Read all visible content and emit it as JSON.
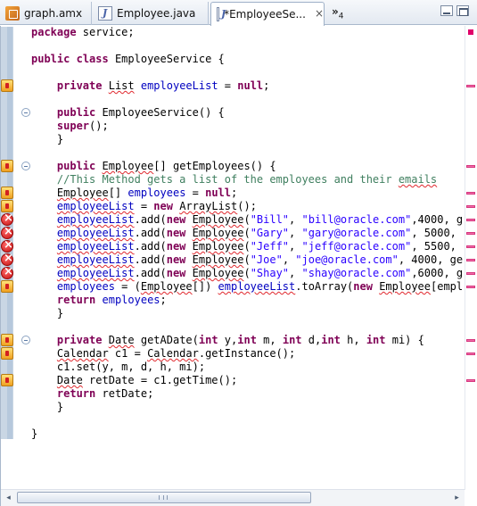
{
  "tabs": [
    {
      "label": "graph.amx",
      "icon": "amx-diagram-icon"
    },
    {
      "label": "Employee.java",
      "icon": "java-file-icon"
    },
    {
      "label": "*EmployeeSe...",
      "icon": "java-file-icon",
      "active": true,
      "close": "×"
    }
  ],
  "overflow": {
    "label": "»",
    "count": "4"
  },
  "code": {
    "l1": {
      "kw": "package",
      "rest": " service;"
    },
    "l3": {
      "kw1": "public",
      "kw2": "class",
      "rest": " EmployeeService {"
    },
    "l5": {
      "kw": "private",
      "type": "List",
      "field": "employeeList",
      "eq": " = ",
      "val": "null",
      "end": ";"
    },
    "l7": {
      "kw": "public",
      "rest": " EmployeeService() {"
    },
    "l8": {
      "kw": "super",
      "rest": "();"
    },
    "l9": {
      "text": "}"
    },
    "l11": {
      "kw": "public",
      "type": "Employee",
      "rest": "[] getEmployees() {"
    },
    "l12": {
      "comment": "//This Method gets a list of the employees and their ",
      "comment_err": "emails"
    },
    "l13": {
      "type": "Employee",
      "rest": "[] ",
      "field": "employees",
      "eq": " = ",
      "val": "null",
      "end": ";"
    },
    "l14": {
      "field": "employeeList",
      "eq": " = ",
      "kw": "new",
      "type": "ArrayList",
      "end": "();"
    },
    "rows": [
      {
        "field": "employeeList",
        "mid": ".add(",
        "kw": "new",
        "type": "Employee",
        "s1": "\"Bill\"",
        "c1": ", ",
        "s2": "\"bill@oracle.com\"",
        "tail": ",4000, g"
      },
      {
        "field": "employeeList",
        "mid": ".add(",
        "kw": "new",
        "type": "Employee",
        "s1": "\"Gary\"",
        "c1": ", ",
        "s2": "\"gary@oracle.com\"",
        "tail": ", 5000, "
      },
      {
        "field": "employeeList",
        "mid": ".add(",
        "kw": "new",
        "type": "Employee",
        "s1": "\"Jeff\"",
        "c1": ", ",
        "s2": "\"jeff@oracle.com\"",
        "tail": ", 5500, "
      },
      {
        "field": "employeeList",
        "mid": ".add(",
        "kw": "new",
        "type": "Employee",
        "s1": "\"Joe\"",
        "c1": ", ",
        "s2": "\"joe@oracle.com\"",
        "tail": ", 4000, ge"
      },
      {
        "field": "employeeList",
        "mid": ".add(",
        "kw": "new",
        "type": "Employee",
        "s1": "\"Shay\"",
        "c1": ", ",
        "s2": "\"shay@oracle.com\"",
        "tail": ",6000, g"
      }
    ],
    "l20": {
      "field": "employees",
      "mid": " = (",
      "type": "Employee",
      "mid2": "[]) ",
      "field2": "employeeList",
      "mid3": ".toArray(",
      "kw": "new",
      "type2": "Employee",
      "tail": "[empl"
    },
    "l21": {
      "kw": "return",
      "field": " employees",
      "end": ";"
    },
    "l22": {
      "text": "}"
    },
    "l24": {
      "kw": "private",
      "type": "Date",
      "rest": " getADate(",
      "k1": "int",
      "r1": " y,",
      "k2": "int",
      "r2": " m, ",
      "k3": "int",
      "r3": " d,",
      "k4": "int",
      "r4": " h, ",
      "k5": "int",
      "r5": " mi) {"
    },
    "l25": {
      "type": "Calendar",
      "rest": " c1 = ",
      "type2": "Calendar",
      "end": ".getInstance();"
    },
    "l26": {
      "text": "c1.set(y, m, d, h, mi);"
    },
    "l27": {
      "type": "Date",
      "rest": " retDate = c1.getTime();"
    },
    "l28": {
      "kw": "return",
      "rest": " retDate;"
    },
    "l29": {
      "text": "}"
    },
    "l31": {
      "text": "}"
    }
  },
  "scroll": {
    "left": "◂",
    "right": "▸"
  }
}
